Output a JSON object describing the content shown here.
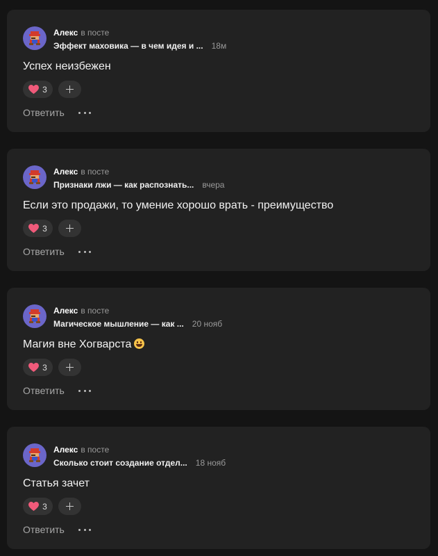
{
  "comments": [
    {
      "author": "Алекс",
      "context": "в посте",
      "post_title": "Эффект маховика — в чем идея и ...",
      "time": "18м",
      "text": "Успех неизбежен",
      "reaction": {
        "emoji": "red-heart",
        "count": "3"
      },
      "reply_label": "Ответить"
    },
    {
      "author": "Алекс",
      "context": "в посте",
      "post_title": "Признаки лжи — как распознать...",
      "time": "вчера",
      "text": "Если это продажи, то умение хорошо врать - преимущество",
      "reaction": {
        "emoji": "red-heart",
        "count": "3"
      },
      "reply_label": "Ответить"
    },
    {
      "author": "Алекс",
      "context": "в посте",
      "post_title": "Магическое мышление — как ...",
      "time": "20 нояб",
      "text": "Магия вне Хогварста",
      "reaction": {
        "emoji": "red-heart",
        "count": "3"
      },
      "reply_label": "Ответить"
    },
    {
      "author": "Алекс",
      "context": "в посте",
      "post_title": "Сколько стоит создание отдел...",
      "time": "18 нояб",
      "text": "Статья зачет",
      "reaction": {
        "emoji": "red-heart",
        "count": "3"
      },
      "reply_label": "Ответить"
    }
  ],
  "colors": {
    "background": "#141414",
    "card": "#222222",
    "pill": "#333333",
    "heart": "#f05a7a",
    "avatar_bg": "#6b66c9"
  },
  "icons": {
    "avatar": "pixel-mario-avatar",
    "reaction": "red-heart-icon",
    "add": "plus-icon",
    "more": "more-dots-icon",
    "emoji_inline": "grinning-face-emoji"
  }
}
